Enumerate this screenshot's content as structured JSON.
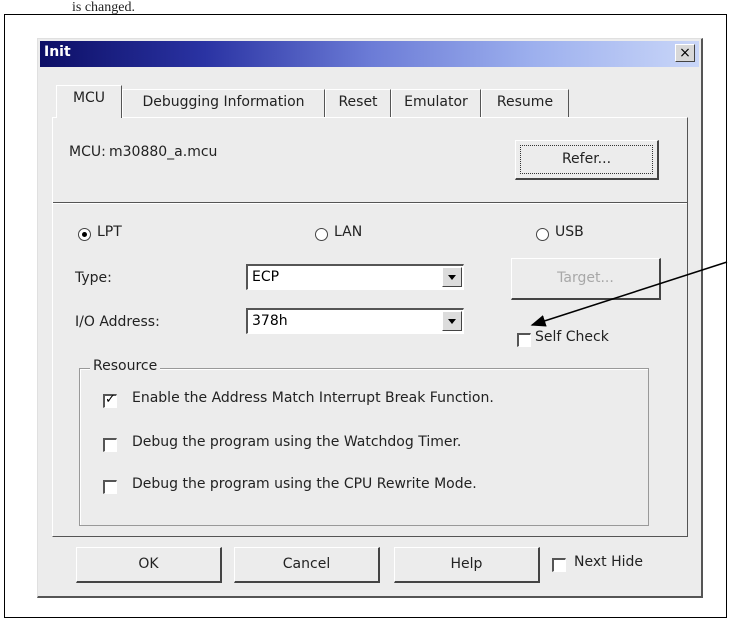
{
  "doc_text": "is changed.",
  "window": {
    "title": "Init",
    "close_glyph": "×"
  },
  "tabs": [
    "MCU",
    "Debugging Information",
    "Reset",
    "Emulator",
    "Resume"
  ],
  "mcu": {
    "label": "MCU:",
    "value": "m30880_a.mcu",
    "refer_button": "Refer..."
  },
  "interface": {
    "options": [
      "LPT",
      "LAN",
      "USB"
    ],
    "selected": "LPT"
  },
  "type": {
    "label": "Type:",
    "value": "ECP"
  },
  "io_address": {
    "label": "I/O Address:",
    "value": "378h"
  },
  "target_button": "Target...",
  "self_check": {
    "label": "Self Check",
    "checked": false
  },
  "resource": {
    "title": "Resource",
    "items": [
      {
        "label": "Enable the Address Match Interrupt Break Function.",
        "checked": true
      },
      {
        "label": "Debug the program using the Watchdog Timer.",
        "checked": false
      },
      {
        "label": "Debug the program using the CPU Rewrite Mode.",
        "checked": false
      }
    ]
  },
  "footer": {
    "ok": "OK",
    "cancel": "Cancel",
    "help": "Help",
    "next_hide": "Next Hide",
    "next_hide_checked": false
  },
  "colors": {
    "title_gradient_start": "#0d0f66",
    "title_gradient_end": "#c9d6f8",
    "dialog_face": "#ececec"
  }
}
